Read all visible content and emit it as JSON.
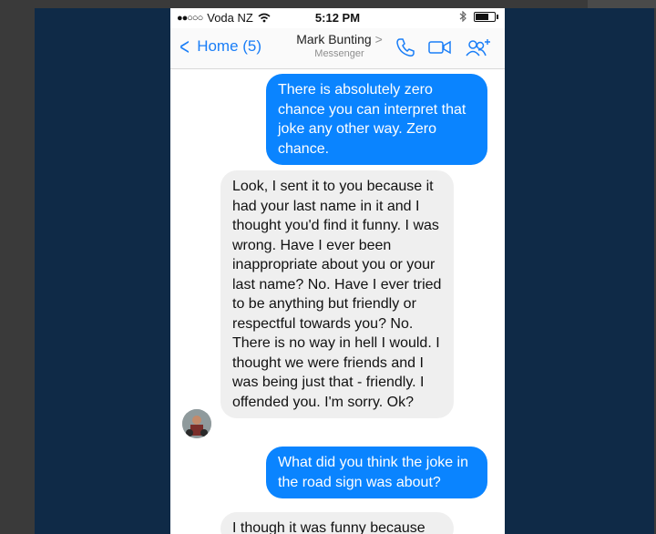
{
  "status_bar": {
    "carrier": "Voda NZ",
    "time": "5:12 PM",
    "signal_icon": "signal-dots-icon",
    "wifi_icon": "wifi-icon",
    "bluetooth_icon": "bluetooth-icon",
    "battery_icon": "battery-icon",
    "battery_level": 0.7
  },
  "header": {
    "back_label": "Home (5)",
    "contact_name": "Mark Bunting",
    "contact_chevron": ">",
    "contact_subtitle": "Messenger",
    "call_icon": "phone-icon",
    "video_icon": "video-camera-icon",
    "add_people_icon": "add-people-icon"
  },
  "colors": {
    "outgoing_bubble": "#0a84ff",
    "incoming_bubble": "#efefef",
    "accent": "#1a7ef7",
    "background": "#0f2a47"
  },
  "messages": [
    {
      "direction": "outgoing",
      "text": "There is absolutely zero chance you can interpret that joke any other way. Zero chance."
    },
    {
      "direction": "incoming",
      "text": "Look, I sent it to you because it had your last name in it and I thought you'd find it funny. I was wrong. Have I ever been inappropriate about you or your last name? No. Have I ever tried to be anything but friendly or respectful towards you? No. There is no way in hell I would. I thought we were friends and I was being just that - friendly. I offended you. I'm sorry. Ok?"
    },
    {
      "direction": "outgoing",
      "text": "What did you think the joke in the road sign was about?"
    },
    {
      "direction": "incoming",
      "text": "I though it was funny because"
    }
  ]
}
